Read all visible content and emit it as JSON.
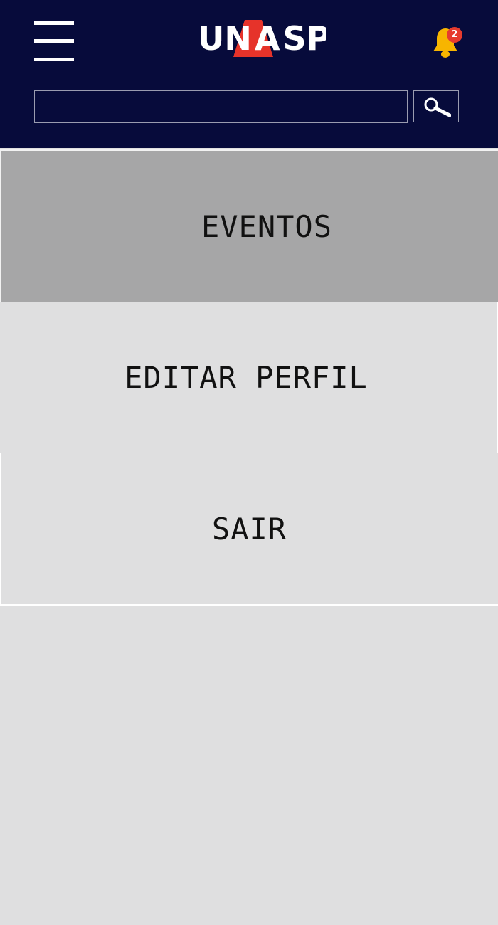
{
  "header": {
    "brand": "UNASP",
    "brand_parts": [
      "UN",
      "A",
      "SP"
    ],
    "accent_color": "#e6332a",
    "background_color": "#070b3b",
    "menu_icon": "hamburger-menu-icon",
    "notifications": {
      "icon": "bell-icon",
      "count": "2",
      "icon_color": "#f7b500",
      "badge_color": "#e63b2e"
    },
    "search": {
      "placeholder": "",
      "value": "",
      "button_icon": "magnifier-icon"
    }
  },
  "menu": {
    "items": [
      {
        "label": "EVENTOS",
        "active": true
      },
      {
        "label": "EDITAR PERFIL",
        "active": false
      },
      {
        "label": "SAIR",
        "active": false
      }
    ],
    "active_color": "#a6a6a7",
    "inactive_color": "#dfdfe0"
  }
}
